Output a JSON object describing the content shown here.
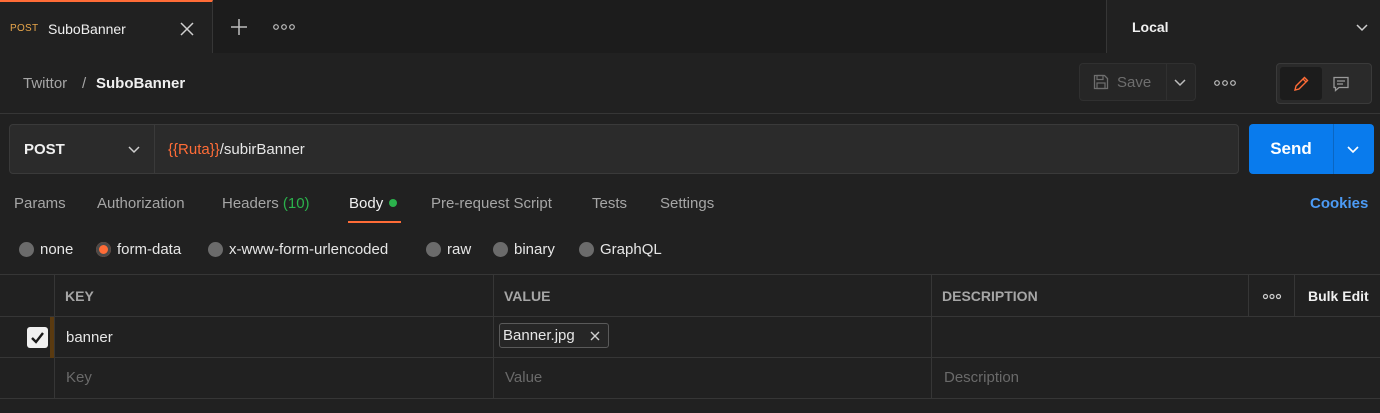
{
  "tab": {
    "method": "POST",
    "name": "SuboBanner"
  },
  "environment": {
    "label": "Local"
  },
  "breadcrumb": {
    "parent": "Twittor",
    "separator": "/",
    "current": "SuboBanner"
  },
  "toolbar": {
    "save_label": "Save"
  },
  "request": {
    "method": "POST",
    "url_variable": "{{Ruta}}",
    "url_path": "/subirBanner",
    "send_label": "Send"
  },
  "request_tabs": {
    "params": "Params",
    "authorization": "Authorization",
    "headers": "Headers",
    "headers_count": "(10)",
    "body": "Body",
    "pre_request": "Pre-request Script",
    "tests": "Tests",
    "settings": "Settings",
    "cookies": "Cookies"
  },
  "body_types": {
    "none": "none",
    "form_data": "form-data",
    "urlencoded": "x-www-form-urlencoded",
    "raw": "raw",
    "binary": "binary",
    "graphql": "GraphQL",
    "selected": "form-data"
  },
  "table": {
    "headers": {
      "key": "KEY",
      "value": "VALUE",
      "description": "DESCRIPTION",
      "bulk_edit": "Bulk Edit"
    },
    "rows": [
      {
        "checked": true,
        "key": "banner",
        "value_file": "Banner.jpg",
        "description": ""
      }
    ],
    "placeholders": {
      "key": "Key",
      "value": "Value",
      "description": "Description"
    }
  },
  "colors": {
    "accent": "#ff6c37",
    "send": "#097bed",
    "count_green": "#2bb24c",
    "link_blue": "#4c9bf5"
  }
}
